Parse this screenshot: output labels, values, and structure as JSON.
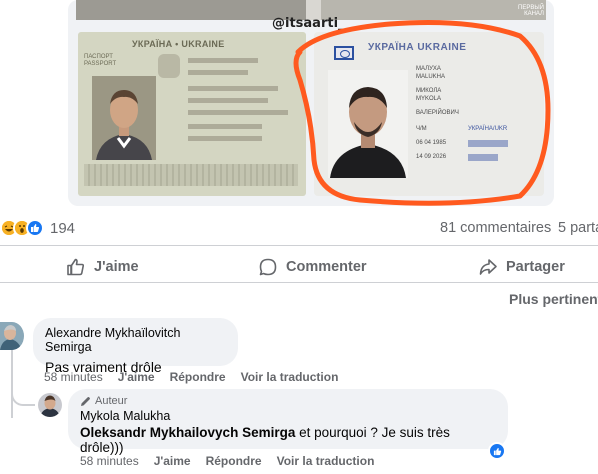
{
  "post_image": {
    "watermark": "@itsaarti_",
    "passport_header": "УКРАЇНА • UKRAINE",
    "passport_side_label": "ПАСПОРТ PASSPORT",
    "id_card_title": "УКРАЇНА UKRAINE",
    "id_card_fields": [
      "МАЛУХА",
      "MALUKHA",
      "МИКОЛА",
      "MYKOLA",
      "ВАЛЕРІЙОВИЧ",
      "Ч/M",
      "06 04 1985",
      "14 09 2026"
    ],
    "id_card_right_fields": [
      "УКРАЇНА/UKR",
      "ЗРАЗОК"
    ],
    "corner_tag_line1": "ПЕРВЫЙ",
    "corner_tag_line2": "КАНАЛ"
  },
  "reactions": {
    "count": "194",
    "emoji": [
      "haha-icon",
      "wow-icon",
      "like-icon"
    ]
  },
  "stats": {
    "comments": "81 commentaires",
    "shares": "5 parta"
  },
  "actions": {
    "like": "J'aime",
    "comment": "Commenter",
    "share": "Partager"
  },
  "sort": {
    "label": "Plus pertinent"
  },
  "comments": [
    {
      "author": "Alexandre Mykhaïlovitch Semirga",
      "text": "Pas vraiment drôle",
      "time": "58 minutes",
      "like": "J'aime",
      "reply": "Répondre",
      "translate": "Voir la traduction"
    }
  ],
  "reply": {
    "badge": "Auteur",
    "author": "Mykola Malukha",
    "mention": "Oleksandr Mykhailovych Semirga",
    "text": " et pourquoi ? Je suis très drôle)))",
    "time": "58 minutes",
    "like": "J'aime",
    "reply": "Répondre",
    "translate": "Voir la traduction"
  },
  "colors": {
    "accent": "#1877f2",
    "secondary_text": "#65676b",
    "bubble": "#f0f2f5",
    "scribble": "#ff5a1f"
  }
}
